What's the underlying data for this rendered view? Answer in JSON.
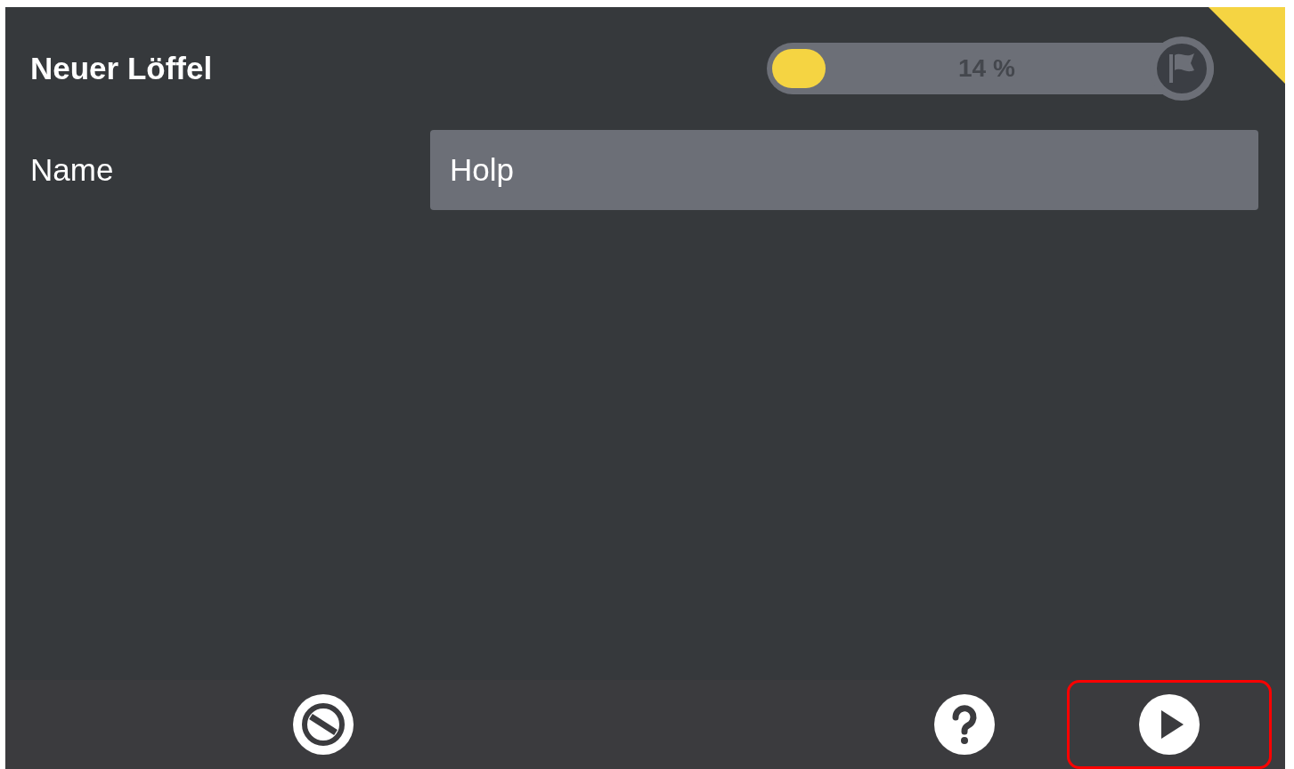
{
  "header": {
    "title": "Neuer Löffel",
    "progress": {
      "level": 0.14,
      "reading": "14 %"
    }
  },
  "form": {
    "fields": [
      {
        "label": "Name",
        "value": "Holp"
      }
    ]
  },
  "footer": {
    "buttons": [
      {
        "kind": "cancel",
        "highlighted": false
      },
      {
        "kind": "help",
        "highlighted": false
      },
      {
        "kind": "next",
        "highlighted": true
      }
    ]
  }
}
